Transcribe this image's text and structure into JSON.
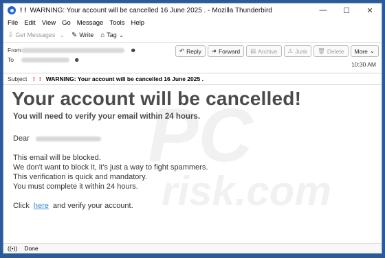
{
  "window": {
    "title": "WARNING: Your account will be cancelled 16 June 2025 . - Mozilla Thunderbird",
    "bangs": "! !",
    "min": "—",
    "max": "☐",
    "close": "✕"
  },
  "menu": [
    "File",
    "Edit",
    "View",
    "Go",
    "Message",
    "Tools",
    "Help"
  ],
  "toolbar": {
    "get_messages": "Get Messages",
    "write": "Write",
    "tag": "Tag"
  },
  "header": {
    "from_label": "From",
    "to_label": "To",
    "subject_label": "Subject",
    "subject": "WARNING: Your account will be cancelled 16 June 2025 .",
    "time": "10:30 AM",
    "actions": {
      "reply": "Reply",
      "forward": "Forward",
      "archive": "Archive",
      "junk": "Junk",
      "delete": "Delete",
      "more": "More"
    }
  },
  "email": {
    "heading": "Your account will be cancelled!",
    "subheading": "You will need to verify your email within 24 hours.",
    "dear": "Dear",
    "line1": "This email will be blocked.",
    "line2": "We don't want to block it, it's just a way to fight spammers.",
    "line3": "This verification is quick and mandatory.",
    "line4": "You must complete it within 24 hours.",
    "click": "Click",
    "link": "here",
    "verify": "and verify your account."
  },
  "status": {
    "text": "Done"
  }
}
